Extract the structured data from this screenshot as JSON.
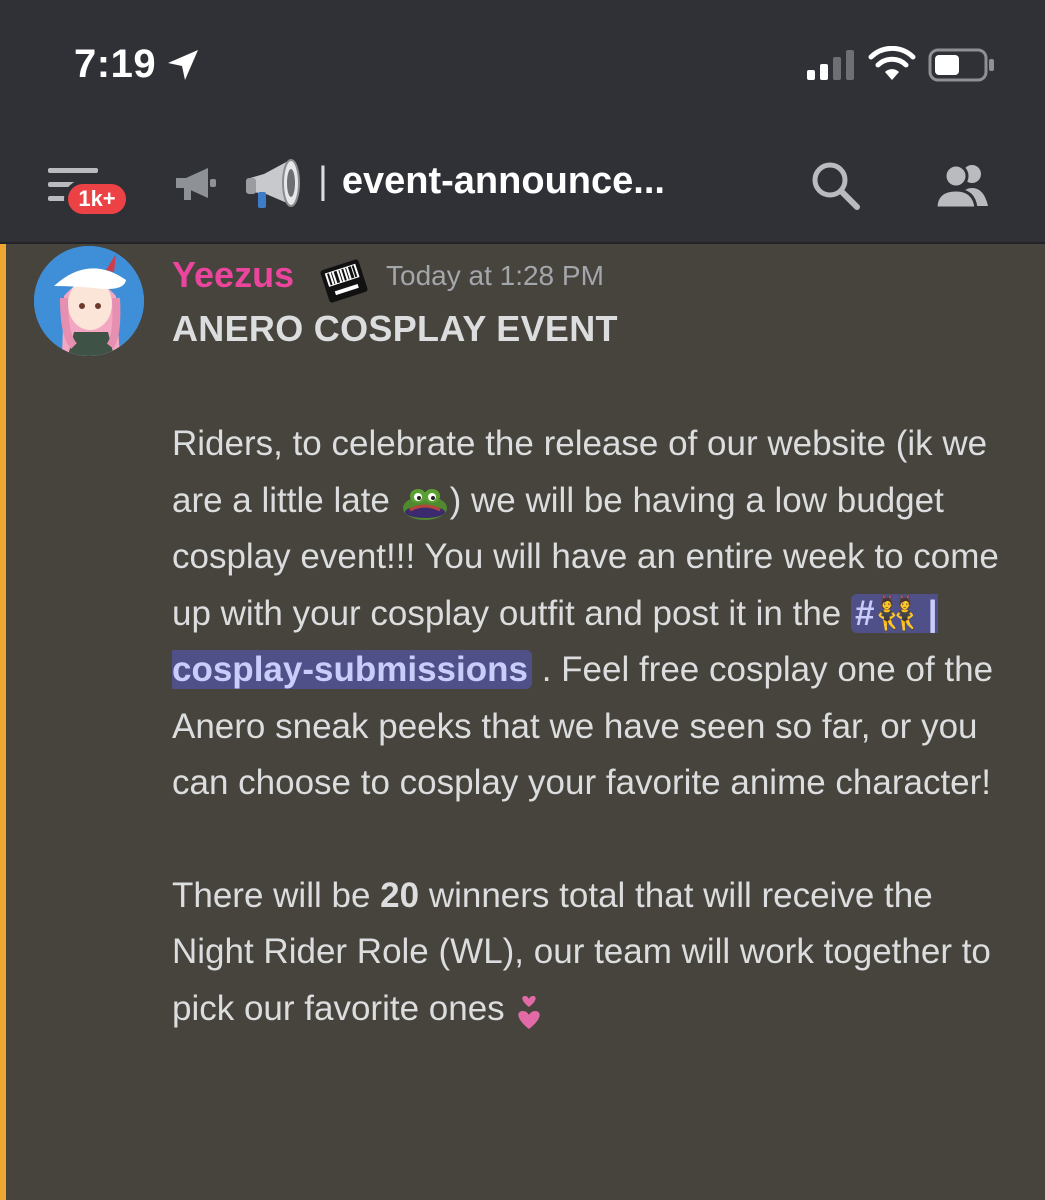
{
  "status_bar": {
    "time": "7:19",
    "icons": [
      "location-arrow-icon",
      "cellular-signal-icon",
      "wifi-icon",
      "battery-icon"
    ]
  },
  "header": {
    "badge": "1k+",
    "channel_separator": "|",
    "channel_name": "event-announce...",
    "icons": [
      "menu-icon",
      "announcement-channel-icon",
      "megaphone-emoji",
      "search-icon",
      "members-icon"
    ]
  },
  "message": {
    "username": "Yeezus",
    "username_color": "#eb459e",
    "timestamp": "Today at 1:28 PM",
    "title": "ANERO COSPLAY EVENT",
    "p1_a": "Riders, to celebrate the release of our website (ik we are a little late",
    "p1_b": ") we will be having a low budget cosplay event!!! You will have an entire week to come up with your cosplay outfit and post it in the",
    "mention": "#👯 | cosplay-submissions",
    "p1_c": ". Feel free cosplay one of the Anero sneak peeks that we have seen so far, or you can choose to cosplay your favorite anime character!",
    "p2_a": "There will be",
    "p2_bold": "20",
    "p2_b": "winners total that will receive the Night Rider Role (WL), our team will work together to pick our favorite ones"
  },
  "colors": {
    "background": "#47443d",
    "header_bg": "#2f3136",
    "accent_bar": "#f0a731",
    "mention_bg": "#4f5087",
    "badge": "#ed4245"
  }
}
